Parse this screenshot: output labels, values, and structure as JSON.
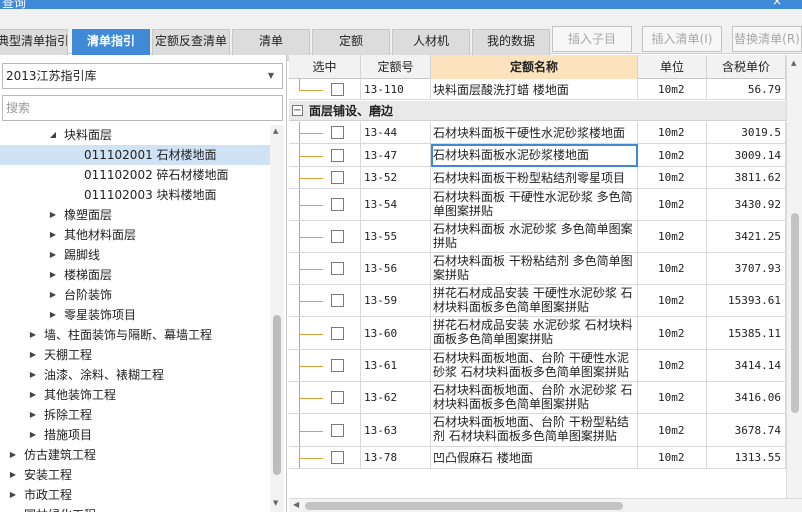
{
  "window": {
    "title": "查询",
    "close_glyph": "×"
  },
  "tabs": [
    {
      "label": "典型清单指引",
      "active": false
    },
    {
      "label": "清单指引",
      "active": true
    },
    {
      "label": "定额反查清单",
      "active": false
    },
    {
      "label": "清单",
      "active": false
    },
    {
      "label": "定额",
      "active": false
    },
    {
      "label": "人材机",
      "active": false
    },
    {
      "label": "我的数据",
      "active": false
    }
  ],
  "toolbar": {
    "insert_child": "插入子目",
    "insert_list": "插入清单(I)",
    "replace_list": "替换清单(R)"
  },
  "library": {
    "selected": "2013江苏指引库"
  },
  "search": {
    "placeholder": "搜索",
    "value": ""
  },
  "tree": [
    {
      "label": "块料面层",
      "level": 3,
      "toggle": "open"
    },
    {
      "label": "011102001  石材楼地面",
      "level": 4,
      "toggle": "none",
      "selected": true
    },
    {
      "label": "011102002  碎石材楼地面",
      "level": 4,
      "toggle": "none"
    },
    {
      "label": "011102003  块料楼地面",
      "level": 4,
      "toggle": "none"
    },
    {
      "label": "橡塑面层",
      "level": 3,
      "toggle": "closed"
    },
    {
      "label": "其他材料面层",
      "level": 3,
      "toggle": "closed"
    },
    {
      "label": "踢脚线",
      "level": 3,
      "toggle": "closed"
    },
    {
      "label": "楼梯面层",
      "level": 3,
      "toggle": "closed"
    },
    {
      "label": "台阶装饰",
      "level": 3,
      "toggle": "closed"
    },
    {
      "label": "零星装饰项目",
      "level": 3,
      "toggle": "closed"
    },
    {
      "label": "墙、柱面装饰与隔断、幕墙工程",
      "level": 2,
      "toggle": "closed"
    },
    {
      "label": "天棚工程",
      "level": 2,
      "toggle": "closed"
    },
    {
      "label": "油漆、涂料、裱糊工程",
      "level": 2,
      "toggle": "closed"
    },
    {
      "label": "其他装饰工程",
      "level": 2,
      "toggle": "closed"
    },
    {
      "label": "拆除工程",
      "level": 2,
      "toggle": "closed"
    },
    {
      "label": "措施项目",
      "level": 2,
      "toggle": "closed"
    },
    {
      "label": "仿古建筑工程",
      "level": 1,
      "toggle": "closed"
    },
    {
      "label": "安装工程",
      "level": 1,
      "toggle": "closed"
    },
    {
      "label": "市政工程",
      "level": 1,
      "toggle": "closed"
    },
    {
      "label": "园林绿化工程",
      "level": 1,
      "toggle": "closed"
    }
  ],
  "grid": {
    "columns": [
      "选中",
      "定额号",
      "定额名称",
      "单位",
      "含税单价"
    ],
    "top_row": {
      "code": "13-110",
      "name": "块料面层酸洗打蜡 楼地面",
      "unit": "10m2",
      "price": "56.79"
    },
    "group": {
      "label": "面层铺设、磨边",
      "toggle": "−"
    },
    "rows": [
      {
        "code": "13-44",
        "name": "石材块料面板干硬性水泥砂浆楼地面",
        "unit": "10m2",
        "price": "3019.5"
      },
      {
        "code": "13-47",
        "name": "石材块料面板水泥砂浆楼地面",
        "unit": "10m2",
        "price": "3009.14",
        "focused": true
      },
      {
        "code": "13-52",
        "name": "石材块料面板干粉型粘结剂零星项目",
        "unit": "10m2",
        "price": "3811.62"
      },
      {
        "code": "13-54",
        "name": "石材块料面板 干硬性水泥砂浆 多色简单图案拼贴",
        "unit": "10m2",
        "price": "3430.92"
      },
      {
        "code": "13-55",
        "name": "石材块料面板 水泥砂浆 多色简单图案拼贴",
        "unit": "10m2",
        "price": "3421.25"
      },
      {
        "code": "13-56",
        "name": "石材块料面板 干粉粘结剂 多色简单图案拼贴",
        "unit": "10m2",
        "price": "3707.93"
      },
      {
        "code": "13-59",
        "name": "拼花石材成品安装 干硬性水泥砂浆 石材块料面板多色简单图案拼贴",
        "unit": "10m2",
        "price": "15393.61"
      },
      {
        "code": "13-60",
        "name": "拼花石材成品安装 水泥砂浆 石材块料面板多色简单图案拼贴",
        "unit": "10m2",
        "price": "15385.11"
      },
      {
        "code": "13-61",
        "name": "石材块料面板地面、台阶 干硬性水泥砂浆 石材块料面板多色简单图案拼贴",
        "unit": "10m2",
        "price": "3414.14"
      },
      {
        "code": "13-62",
        "name": "石材块料面板地面、台阶 水泥砂浆 石材块料面板多色简单图案拼贴",
        "unit": "10m2",
        "price": "3416.06"
      },
      {
        "code": "13-63",
        "name": "石材块料面板地面、台阶 干粉型粘结剂 石材块料面板多色简单图案拼贴",
        "unit": "10m2",
        "price": "3678.74"
      },
      {
        "code": "13-78",
        "name": "凹凸假麻石 楼地面",
        "unit": "10m2",
        "price": "1313.55"
      }
    ]
  },
  "colors": {
    "accent": "#3f89d6",
    "header_highlight": "#fde3bd",
    "selection": "#cfe3f5",
    "tree_line": "#e0a040"
  }
}
